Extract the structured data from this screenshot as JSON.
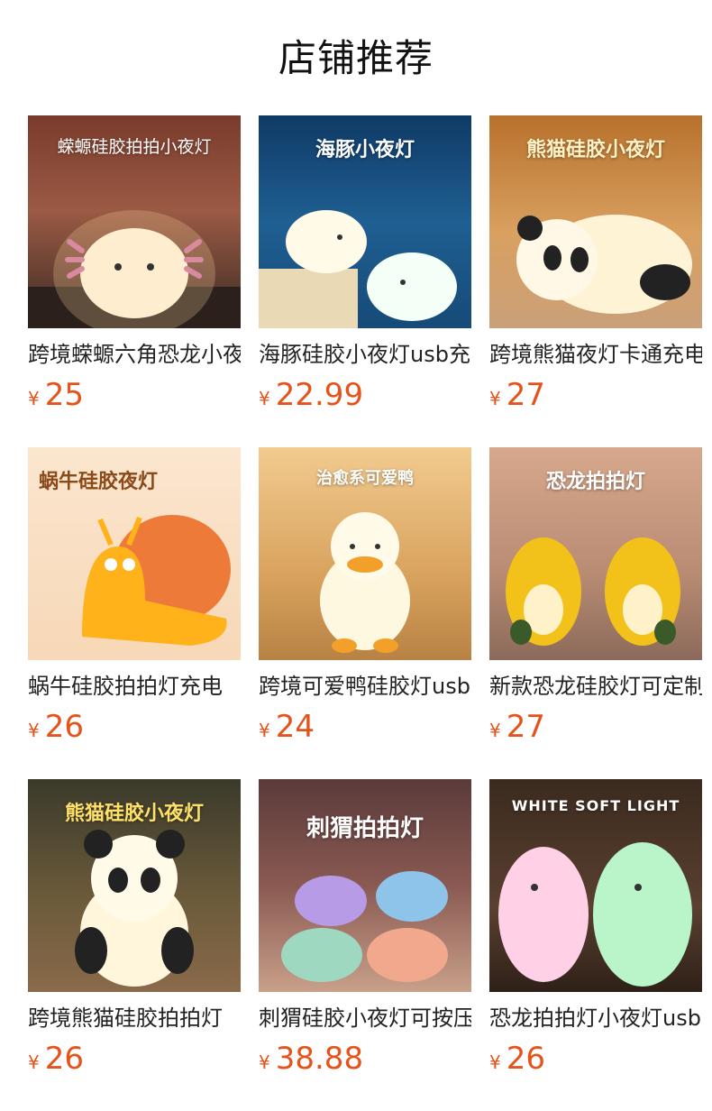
{
  "section": {
    "title": "店铺推荐"
  },
  "currency_symbol": "¥",
  "products": [
    {
      "name": "跨境蝾螈六角恐龙小夜灯",
      "price": "25",
      "banner": "蝾螈硅胶拍拍小夜灯"
    },
    {
      "name": "海豚硅胶小夜灯usb充电",
      "price": "22.99",
      "banner": "海豚小夜灯"
    },
    {
      "name": "跨境熊猫夜灯卡通充电",
      "price": "27",
      "banner": "熊猫硅胶小夜灯"
    },
    {
      "name": "蜗牛硅胶拍拍灯充电",
      "price": "26",
      "banner": "蜗牛硅胶夜灯"
    },
    {
      "name": "跨境可爱鸭硅胶灯usb",
      "price": "24",
      "banner": "治愈系可爱鸭"
    },
    {
      "name": "新款恐龙硅胶灯可定制",
      "price": "27",
      "banner": "恐龙拍拍灯"
    },
    {
      "name": "跨境熊猫硅胶拍拍灯",
      "price": "26",
      "banner": "熊猫硅胶小夜灯"
    },
    {
      "name": "刺猬硅胶小夜灯可按压",
      "price": "38.88",
      "banner": "刺猬拍拍灯"
    },
    {
      "name": "恐龙拍拍灯小夜灯usb",
      "price": "26",
      "banner": "WHITE SOFT LIGHT"
    }
  ]
}
